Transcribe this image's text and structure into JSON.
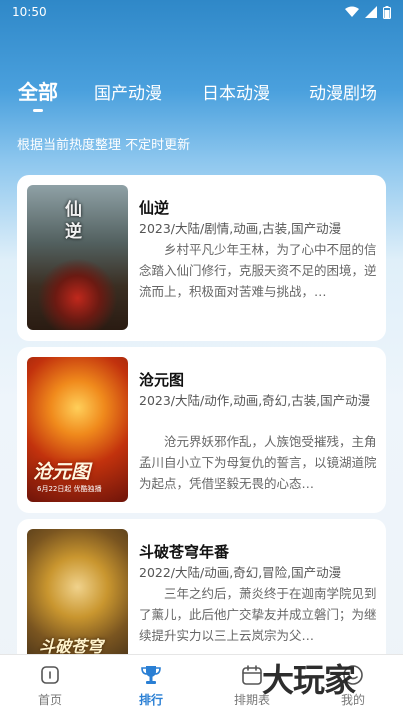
{
  "status_bar": {
    "time": "10:50"
  },
  "tabs": [
    {
      "label": "全部",
      "active": true
    },
    {
      "label": "国产动漫",
      "active": false
    },
    {
      "label": "日本动漫",
      "active": false
    },
    {
      "label": "动漫剧场",
      "active": false
    }
  ],
  "subtitle": "根据当前热度整理 不定时更新",
  "cards": [
    {
      "title": "仙逆",
      "tags": "2023/大陆/剧情,动画,古装,国产动漫",
      "desc": "乡村平凡少年王林，为了心中不屈的信念踏入仙门修行，克服天资不足的困境，逆流而上，积极面对苦难与挑战，…",
      "cover_text": "仙逆"
    },
    {
      "title": "沧元图",
      "tags": "2023/大陆/动作,动画,奇幻,古装,国产动漫",
      "desc": "沧元界妖邪作乱，人族饱受摧残，主角孟川自小立下为母复仇的誓言，以镜湖道院为起点，凭借坚毅无畏的心态…",
      "cover_text": "沧元图",
      "cover_badge": "6月22日起 优酷独播"
    },
    {
      "title": "斗破苍穹年番",
      "tags": "2022/大陆/动画,奇幻,冒险,国产动漫",
      "desc": "三年之约后，萧炎终于在迦南学院见到了薰儿，此后他广交挚友并成立磐门；为继续提升实力以三上云岚宗为父…",
      "cover_text": "斗破苍穹"
    }
  ],
  "bottom_nav": [
    {
      "label": "首页",
      "icon": "home-icon",
      "active": false
    },
    {
      "label": "排行",
      "icon": "trophy-icon",
      "active": true
    },
    {
      "label": "排期表",
      "icon": "calendar-icon",
      "active": false
    },
    {
      "label": "我的",
      "icon": "profile-icon",
      "active": false
    }
  ],
  "watermark": "大玩家",
  "colors": {
    "accent": "#2a7fd4",
    "header_top": "#2f88c8"
  }
}
